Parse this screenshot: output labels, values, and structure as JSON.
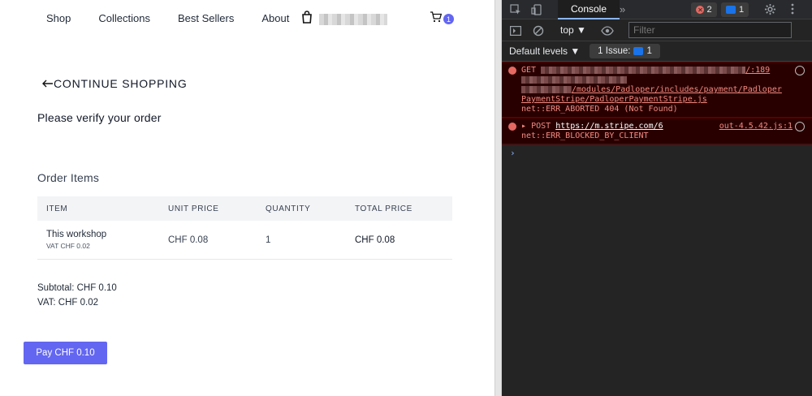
{
  "shop": {
    "nav": [
      "Shop",
      "Collections",
      "Best Sellers",
      "About"
    ],
    "cart_count": "1",
    "continue_label": "CONTINUE SHOPPING",
    "verify_heading": "Please verify your order",
    "order_items_heading": "Order Items",
    "table": {
      "headers": [
        "ITEM",
        "UNIT PRICE",
        "QUANTITY",
        "TOTAL PRICE"
      ],
      "rows": [
        {
          "item": "This workshop",
          "vat": "VAT CHF 0.02",
          "unit_price": "CHF 0.08",
          "quantity": "1",
          "total_price": "CHF 0.08"
        }
      ]
    },
    "subtotal": "Subtotal: CHF 0.10",
    "vat_total": "VAT: CHF 0.02",
    "pay_label": "Pay CHF 0.10"
  },
  "devtools": {
    "active_tab": "Console",
    "error_count": "2",
    "message_count": "1",
    "context": "top ▼",
    "filter_placeholder": "Filter",
    "levels": "Default levels ▼",
    "issue_label": "1 Issue:",
    "issue_count": "1",
    "entries": [
      {
        "method": "GET",
        "url_tail": "/:189",
        "path1": "/modules/Padloper/includes/payment/Padloper",
        "path2": "PaymentStripe/PadloperPaymentStripe.js",
        "status": "net::ERR_ABORTED 404 (Not Found)"
      },
      {
        "method": "POST",
        "url": "https://m.stripe.com/6",
        "source": "out-4.5.42.js:1",
        "status": "net::ERR_BLOCKED_BY_CLIENT"
      }
    ],
    "prompt": "›"
  }
}
